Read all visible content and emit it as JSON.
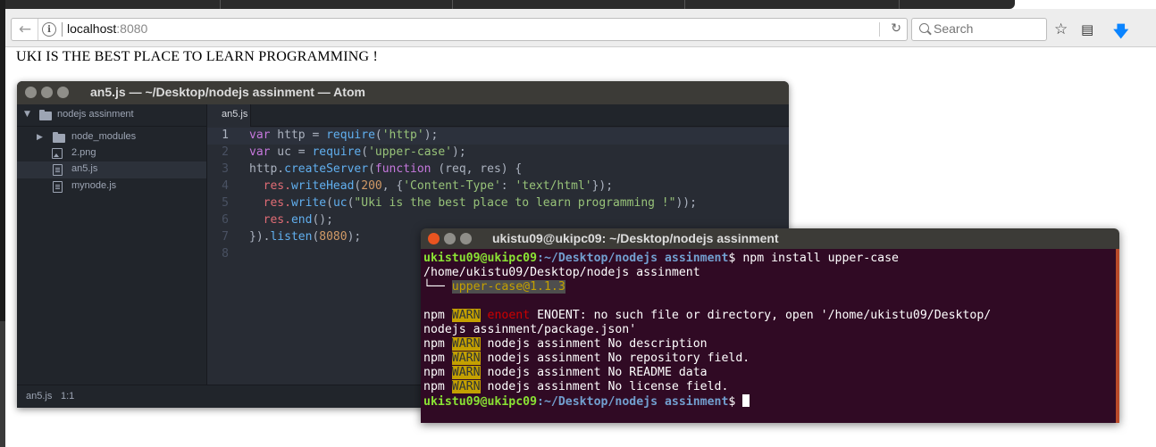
{
  "browser": {
    "url_host": "localhost",
    "url_port": ":8080",
    "search_placeholder": "Search",
    "icons": [
      "back-arrow-icon",
      "info-icon",
      "reload-icon",
      "search-icon",
      "bookmark-star-icon",
      "reader-icon",
      "download-icon"
    ]
  },
  "page": {
    "heading": "UKI IS THE BEST PLACE TO LEARN PROGRAMMING !"
  },
  "atom": {
    "title": "an5.js — ~/Desktop/nodejs assinment — Atom",
    "tree": {
      "root": "nodejs assinment",
      "items": [
        {
          "label": "node_modules",
          "kind": "folder"
        },
        {
          "label": "2.png",
          "kind": "image"
        },
        {
          "label": "an5.js",
          "kind": "file",
          "selected": true
        },
        {
          "label": "mynode.js",
          "kind": "file"
        }
      ]
    },
    "tab": "an5.js",
    "line_numbers": [
      "1",
      "2",
      "3",
      "4",
      "5",
      "6",
      "7",
      "8"
    ],
    "code": {
      "l1_a": "var",
      "l1_b": " http = ",
      "l1_c": "require",
      "l1_d": "(",
      "l1_e": "'http'",
      "l1_f": ");",
      "l2_a": "var",
      "l2_b": " uc = ",
      "l2_c": "require",
      "l2_d": "(",
      "l2_e": "'upper-case'",
      "l2_f": ");",
      "l3_a": "http.",
      "l3_b": "createServer",
      "l3_c": "(",
      "l3_d": "function",
      "l3_e": " (req, res) {",
      "l4_a": "  res.",
      "l4_b": "writeHead",
      "l4_c": "(",
      "l4_d": "200",
      "l4_e": ", {",
      "l4_f": "'Content-Type'",
      "l4_g": ": ",
      "l4_h": "'text/html'",
      "l4_i": "});",
      "l5_a": "  res.",
      "l5_b": "write",
      "l5_c": "(",
      "l5_d": "uc",
      "l5_e": "(",
      "l5_f": "\"Uki is the best place to learn programming !\"",
      "l5_g": "));",
      "l6_a": "  res.",
      "l6_b": "end",
      "l6_c": "();",
      "l7_a": "}).",
      "l7_b": "listen",
      "l7_c": "(",
      "l7_d": "8080",
      "l7_e": ");"
    },
    "status_file": "an5.js",
    "status_pos": "1:1"
  },
  "terminal": {
    "title": "ukistu09@ukipc09: ~/Desktop/nodejs assinment",
    "prompt_user": "ukistu09@ukipc09",
    "prompt_path": ":~/Desktop/nodejs assinment",
    "prompt_sym": "$",
    "command": " npm install upper-case",
    "install_path": "/home/ukistu09/Desktop/nodejs assinment",
    "tree_branch": "└── ",
    "package": "upper-case@1.1.3",
    "npm": "npm",
    "warn": "WARN",
    "enoent": "enoent",
    "enoent_msg1": " ENOENT: no such file or directory, open '/home/ukistu09/Desktop/",
    "enoent_msg2": "nodejs assinment/package.json'",
    "warn1": " nodejs assinment No description",
    "warn2": " nodejs assinment No repository field.",
    "warn3": " nodejs assinment No README data",
    "warn4": " nodejs assinment No license field."
  }
}
